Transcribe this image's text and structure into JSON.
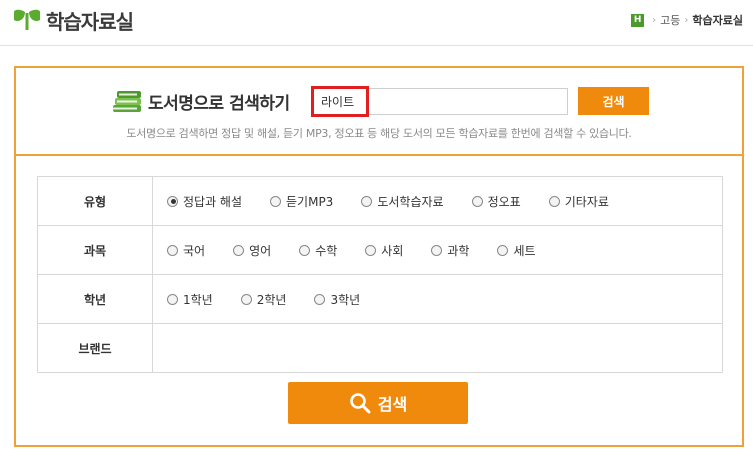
{
  "header": {
    "logo_text": "학습자료실",
    "breadcrumb": {
      "home_badge": "H",
      "level": "고등",
      "current": "학습자료실"
    }
  },
  "book_search": {
    "title": "도서명으로 검색하기",
    "input_value": "라이트",
    "button_label": "검색",
    "description": "도서명으로 검색하면 정답 및 해설, 듣기 MP3, 정오표 등 해당 도서의 모든 학습자료를 한번에 검색할 수 있습니다."
  },
  "filters": {
    "type": {
      "label": "유형",
      "options": [
        "정답과 해설",
        "듣기MP3",
        "도서학습자료",
        "정오표",
        "기타자료"
      ],
      "selected": "정답과 해설"
    },
    "subject": {
      "label": "과목",
      "options": [
        "국어",
        "영어",
        "수학",
        "사회",
        "과학",
        "세트"
      ]
    },
    "grade": {
      "label": "학년",
      "options": [
        "1학년",
        "2학년",
        "3학년"
      ]
    },
    "brand": {
      "label": "브랜드"
    }
  },
  "search_button": {
    "label": "검색"
  },
  "colors": {
    "accent": "#f08a0c",
    "panel_border": "#f0a23a",
    "highlight": "#e02020",
    "logo_green": "#4a9a2c"
  },
  "icons": [
    "logo-leaf-icon",
    "home-h-icon",
    "books-icon",
    "search-magnifier-icon"
  ]
}
